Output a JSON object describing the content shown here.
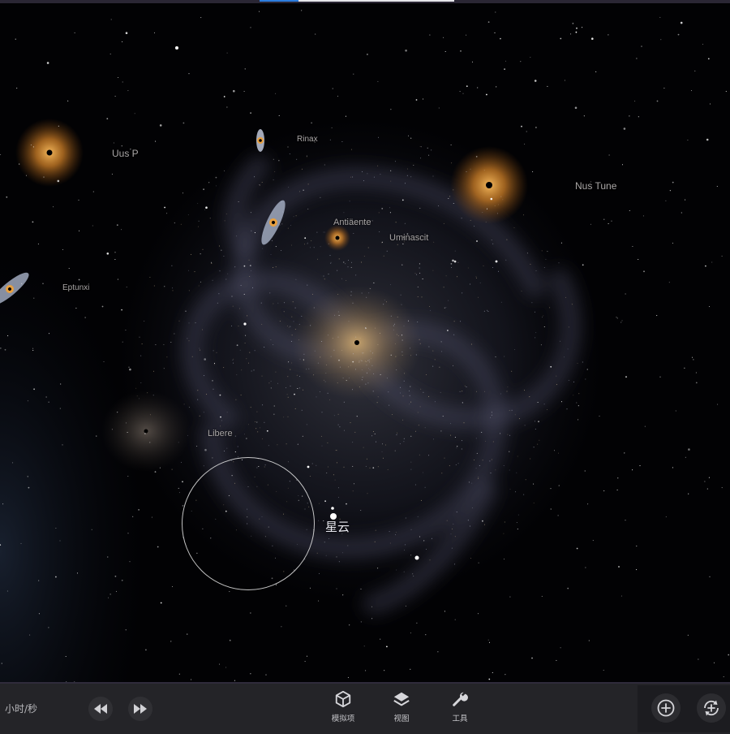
{
  "viewport": {
    "objects": [
      {
        "name": "Uus P"
      },
      {
        "name": "Rinax"
      },
      {
        "name": "Nus Tune"
      },
      {
        "name": "Antiäente"
      },
      {
        "name": "Uminascit"
      },
      {
        "name": "Eptunxi"
      },
      {
        "name": "Libere"
      }
    ],
    "selected": {
      "label": "星云"
    }
  },
  "toolbar": {
    "speed_label": "小时/秒",
    "rewind_icon": "rewind-icon",
    "fast_forward_icon": "fast-forward-icon",
    "tools": [
      {
        "label": "模拟项",
        "icon": "cube-icon"
      },
      {
        "label": "视图",
        "icon": "layers-icon"
      },
      {
        "label": "工具",
        "icon": "wrench-icon"
      }
    ],
    "add_icon": "add-icon",
    "rotate_add_icon": "rotate-add-icon"
  },
  "colors": {
    "background": "#020204",
    "toolbar": "#242428",
    "accent_loading": "#2d7ee0",
    "star_glow": "#f0a030",
    "galaxy_core": "#c9a062"
  }
}
